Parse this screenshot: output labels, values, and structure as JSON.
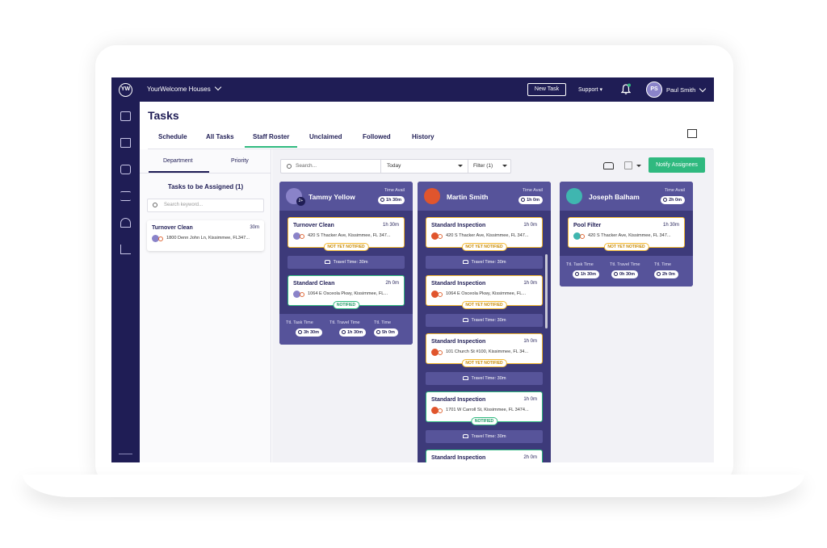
{
  "topbar": {
    "logo": "YW",
    "org": "YourWelcome Houses",
    "new_task": "New Task",
    "support": "Support",
    "user_initials": "PS",
    "user_name": "Paul Smith"
  },
  "page": {
    "title": "Tasks",
    "tabs": [
      "Schedule",
      "All Tasks",
      "Staff Roster",
      "Unclaimed",
      "Followed",
      "History"
    ],
    "active_tab": "Staff Roster"
  },
  "left": {
    "tabs": [
      "Department",
      "Priority"
    ],
    "assign_title": "Tasks to be Assigned (1)",
    "search_placeholder": "Search keyword...",
    "card": {
      "title": "Turnover Clean",
      "duration": "30m",
      "address": "1800 Denn John Ln, Kissimmee, FL347..."
    }
  },
  "toolbar": {
    "search_placeholder": "Search...",
    "date": "Today",
    "filter": "Filter (1)",
    "notify": "Notify Assignees"
  },
  "labels": {
    "time_avail": "Time Avail",
    "travel_prefix": "Travel Time:",
    "ttl_task": "Ttl. Task Time",
    "ttl_travel": "Ttl. Travel Time",
    "ttl_time": "Ttl. Time"
  },
  "staff": [
    {
      "name": "Tammy Yellow",
      "avail": "1h 30m",
      "avatar_color": "#8a83c9",
      "badge": "2+",
      "tasks": [
        {
          "title": "Turnover Clean",
          "duration": "1h 30m",
          "address": "420 S Thacker Ave, Kissimmee, FL 347...",
          "status": "NOT YET NOTIFIED",
          "status_type": "y",
          "travel": "Travel Time: 30m"
        },
        {
          "title": "Standard Clean",
          "duration": "2h 0m",
          "address": "1064 E Osceola Pkwy, Kissimmee, FL...",
          "status": "NOTIFIED",
          "status_type": "g"
        }
      ],
      "totals": {
        "task": "3h 30m",
        "travel": "1h 30m",
        "time": "5h 0m"
      }
    },
    {
      "name": "Martin Smith",
      "avail": "1h 0m",
      "avatar_color": "#e0552d",
      "tasks": [
        {
          "title": "Standard Inspection",
          "duration": "1h 0m",
          "address": "420 S Thacker Ave, Kissimmee, FL 347...",
          "status": "NOT YET NOTIFIED",
          "status_type": "y",
          "travel": "Travel Time: 30m"
        },
        {
          "title": "Standard Inspection",
          "duration": "1h 0m",
          "address": "1064 E Osceola Pkwy, Kissimmee, FL...",
          "status": "NOT YET NOTIFIED",
          "status_type": "y",
          "travel": "Travel Time: 30m"
        },
        {
          "title": "Standard Inspection",
          "duration": "1h 0m",
          "address": "101 Church St #100, Kissimmee, FL 34...",
          "status": "NOT YET NOTIFIED",
          "status_type": "y",
          "travel": "Travel Time: 30m"
        },
        {
          "title": "Standard Inspection",
          "duration": "1h 0m",
          "address": "1701 W Carroll St, Kissimmee, FL 3474...",
          "status": "NOTIFIED",
          "status_type": "g",
          "travel": "Travel Time: 30m"
        },
        {
          "title": "Standard Inspection",
          "duration": "2h 0m",
          "address": "",
          "status": "",
          "status_type": "g"
        }
      ]
    },
    {
      "name": "Joseph Balham",
      "avail": "2h 0m",
      "avatar_color": "#3fb6b0",
      "tasks": [
        {
          "title": "Pool Filter",
          "duration": "1h 30m",
          "address": "420 S Thacker Ave, Kissimmee, FL 347...",
          "status": "NOT YET NOTIFIED",
          "status_type": "y"
        }
      ],
      "totals": {
        "task": "1h 30m",
        "travel": "0h 30m",
        "time": "2h 0m"
      }
    }
  ],
  "colors": {
    "navy": "#1f1d55",
    "green": "#2fb97f",
    "yellow": "#f3b830",
    "column": "#3d3a7a"
  },
  "icons": [
    "logo-icon",
    "calendar-icon",
    "contacts-icon",
    "chat-icon",
    "checklist-icon",
    "service-bell-icon",
    "chart-icon",
    "gear-icon",
    "bell-icon",
    "archive-icon",
    "car-icon",
    "filter-icon"
  ]
}
